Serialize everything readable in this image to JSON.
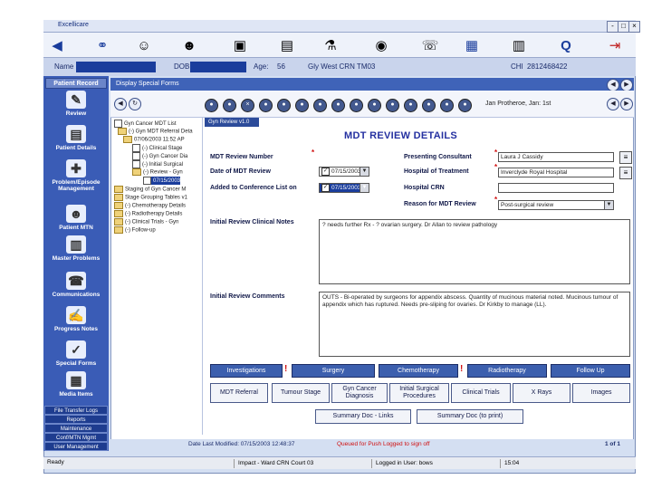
{
  "window": {
    "title": "Excellicare",
    "min": "-",
    "max": "□",
    "close": "×"
  },
  "patient": {
    "name_label": "Name",
    "dob_label": "DOB",
    "age_label": "Age:",
    "age_value": "56",
    "ward_value": "Gly West CRN TM03",
    "chi_label": "CHI",
    "chi_value": "2812468422"
  },
  "sidebar": {
    "header": "Patient Record",
    "items": [
      {
        "label": "Review",
        "icon": "review-icon"
      },
      {
        "label": "Patient Details",
        "icon": "patient-details-icon"
      },
      {
        "label": "Problem/Episode Management",
        "icon": "problem-icon"
      },
      {
        "label": "Patient MTN",
        "icon": "patient-mtn-icon"
      },
      {
        "label": "Master Problems",
        "icon": "master-problems-icon"
      },
      {
        "label": "Communications",
        "icon": "communications-icon"
      },
      {
        "label": "Progress Notes",
        "icon": "progress-notes-icon"
      },
      {
        "label": "Special Forms",
        "icon": "special-forms-icon"
      },
      {
        "label": "Media Items",
        "icon": "media-items-icon"
      }
    ],
    "bottom": [
      "File Transfer Logs",
      "Reports",
      "Maintenance",
      "Conf/MTN Mgmt",
      "User Management"
    ]
  },
  "display": {
    "header": "Display Special Forms",
    "clinician": "Jan Protheroe, Jan: 1st",
    "tab": "Gyn Review v1.0"
  },
  "tree": [
    "Gyn Cancer MDT List",
    "(-) Gyn MDT Referral Deta",
    "07/06/2003 11:52 AP",
    "(-) Clinical Stage",
    "(-) Gyn Cancer Dia",
    "(-) Initial Surgical",
    "(-) Review - Gyn",
    "07/15/2003",
    "Staging of Gyn Cancer M",
    "Stage Grouping Tables v1",
    "(-) Chemotherapy Details",
    "(-) Radiotherapy Details",
    "(-) Clinical Trials - Gyn",
    "(-) Follow-up"
  ],
  "form": {
    "title": "MDT REVIEW DETAILS",
    "mdt_review_number_label": "MDT Review Number",
    "date_of_mdt_review_label": "Date of MDT Review",
    "date_of_mdt_review_value": "07/15/2003",
    "added_to_conf_label": "Added to Conference List on",
    "added_to_conf_value": "07/15/2003",
    "presenting_consultant_label": "Presenting Consultant",
    "presenting_consultant_value": "Laura J Cassidy",
    "hospital_of_treatment_label": "Hospital of Treatment",
    "hospital_of_treatment_value": "Inverclyde Royal Hospital",
    "hospital_crn_label": "Hospital CRN",
    "hospital_crn_value": "",
    "reason_label": "Reason for MDT Review",
    "reason_value": "Post-surgical review",
    "initial_notes_label": "Initial Review Clinical Notes",
    "initial_notes_value": "? needs further Rx - ? ovarian surgery. Dr Allan to review pathology",
    "initial_comments_label": "Initial Review Comments",
    "initial_comments_value": "OUTS - Bi-operated by surgeons for appendix abscess. Quantity of mucinous material noted. Mucinous tumour of appendix which has ruptured. Needs pre-sliping for ovaries. Dr Kirkby to manage (LL)."
  },
  "buttons_row1": [
    "Investigations",
    "Surgery",
    "Chemotherapy",
    "Radiotherapy",
    "Follow Up"
  ],
  "buttons_row2": [
    "MDT Referral",
    "Tumour Stage",
    "Gyn Cancer Diagnosis",
    "Initial Surgical Procedures",
    "Clinical Trials",
    "X Rays",
    "Images"
  ],
  "summary_buttons": [
    "Summary Doc - Links",
    "Summary Doc (to print)"
  ],
  "status": {
    "date_modified": "Date Last Modified: 07/15/2003 12:48:37",
    "queued": "Queued for Push Logged to sign off",
    "pages": "1 of 1"
  },
  "statusbar": {
    "ready": "Ready",
    "location": "Impact - Ward CRN Court 03",
    "logged": "Logged in User: bows",
    "time": "15:04"
  },
  "colors": {
    "accent": "#3a5cb6",
    "required": "#d01010",
    "title": "#2430a0"
  }
}
